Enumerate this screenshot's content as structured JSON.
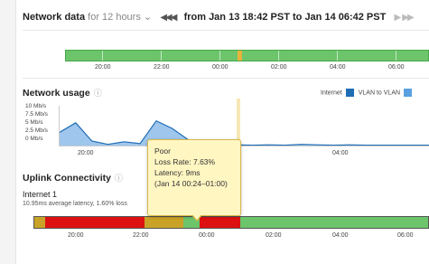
{
  "header": {
    "title": "Network data",
    "duration": "for 12 hours",
    "dropdown_glyph": "⌄",
    "prev_icon": "◀◀◀",
    "range_text": "from Jan 13 18:42 PST to Jan 14 06:42 PST",
    "next_icon": "▶",
    "last_icon": "▶▶"
  },
  "timeline": {
    "ticks": [
      "20:00",
      "22:00",
      "00:00",
      "02:00",
      "04:00",
      "06:00"
    ],
    "marker_color": "#e8b33a"
  },
  "network_usage": {
    "title": "Network usage",
    "info_icon": "ⓘ",
    "legend": [
      {
        "label": "Internet",
        "color": "#1f6db5"
      },
      {
        "label": "VLAN to VLAN",
        "color": "#5aa0e0"
      }
    ],
    "y_labels": [
      "10 Mb/s",
      "7.5 Mb/s",
      "5 Mb/s",
      "2.5 Mb/s",
      "0 Mb/s"
    ],
    "x_labels": [
      "20:00",
      "04:00"
    ]
  },
  "chart_data": {
    "type": "area",
    "ylabel": "",
    "ylim": [
      0,
      10
    ],
    "y_unit": "Mb/s",
    "x": [
      "18:42",
      "19:00",
      "19:20",
      "19:40",
      "20:00",
      "20:20",
      "20:40",
      "21:00",
      "21:20",
      "21:40",
      "22:00",
      "22:20",
      "22:40",
      "23:00",
      "23:20",
      "23:40",
      "00:00",
      "00:20",
      "00:40",
      "01:00",
      "02:00",
      "04:00",
      "06:00",
      "06:42"
    ],
    "series": [
      {
        "name": "Internet",
        "values": [
          3.5,
          6.0,
          1.2,
          0.3,
          1.0,
          0.5,
          6.5,
          4.5,
          1.5,
          0.3,
          0.2,
          0.2,
          0.1,
          0.2,
          0.1,
          0.3,
          0.2,
          0.1,
          0.2,
          0.1,
          0.1,
          0.1,
          0.1,
          0.1
        ]
      }
    ]
  },
  "uplink": {
    "title": "Uplink Connectivity",
    "info_icon": "ⓘ",
    "interface_name": "Internet 1",
    "summary": "10.95ms average latency, 1.60% loss",
    "ticks": [
      "20:00",
      "22:00",
      "00:00",
      "02:00",
      "04:00",
      "06:00"
    ],
    "colors": {
      "good": "#6cc46b",
      "warn": "#c9a227",
      "bad": "#dd1111"
    }
  },
  "tooltip": {
    "status": "Poor",
    "loss": "Loss Rate: 7.63%",
    "latency": "Latency: 9ms",
    "window": "(Jan 14 00:24–01:00)"
  }
}
